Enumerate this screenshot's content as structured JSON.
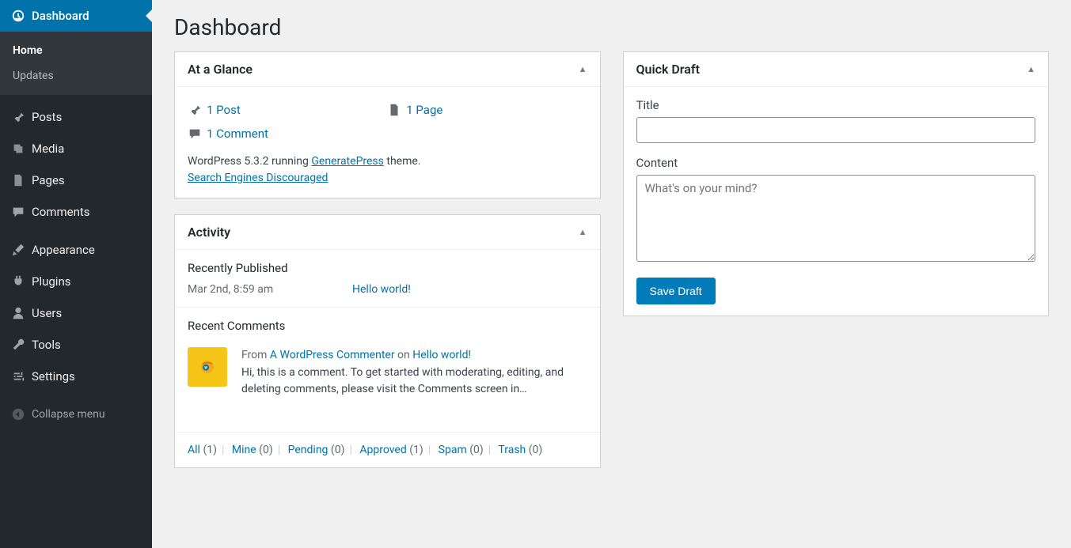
{
  "page": {
    "title": "Dashboard"
  },
  "sidebar": {
    "items": [
      {
        "label": "Dashboard"
      },
      {
        "label": "Posts"
      },
      {
        "label": "Media"
      },
      {
        "label": "Pages"
      },
      {
        "label": "Comments"
      },
      {
        "label": "Appearance"
      },
      {
        "label": "Plugins"
      },
      {
        "label": "Users"
      },
      {
        "label": "Tools"
      },
      {
        "label": "Settings"
      }
    ],
    "submenu": [
      {
        "label": "Home"
      },
      {
        "label": "Updates"
      }
    ],
    "collapse": "Collapse menu"
  },
  "glance": {
    "title": "At a Glance",
    "post": "1 Post",
    "page": "1 Page",
    "comment": "1 Comment",
    "version_prefix": "WordPress 5.3.2 running ",
    "theme": "GeneratePress",
    "version_suffix": " theme.",
    "search_engines": "Search Engines Discouraged"
  },
  "activity": {
    "title": "Activity",
    "recently_published": "Recently Published",
    "pub_date": "Mar 2nd, 8:59 am",
    "pub_title": "Hello world!",
    "recent_comments": "Recent Comments",
    "comment_from": "From ",
    "comment_author": "A WordPress Commenter",
    "comment_on": " on ",
    "comment_post": "Hello world!",
    "comment_body": "Hi, this is a comment. To get started with moderating, editing, and deleting comments, please visit the Comments screen in…",
    "filters": {
      "all": "All",
      "all_count": "(1)",
      "mine": "Mine",
      "mine_count": "(0)",
      "pending": "Pending",
      "pending_count": "(0)",
      "approved": "Approved",
      "approved_count": "(1)",
      "spam": "Spam",
      "spam_count": "(0)",
      "trash": "Trash",
      "trash_count": "(0)"
    }
  },
  "quickdraft": {
    "title": "Quick Draft",
    "title_label": "Title",
    "content_label": "Content",
    "content_placeholder": "What's on your mind?",
    "save": "Save Draft"
  }
}
